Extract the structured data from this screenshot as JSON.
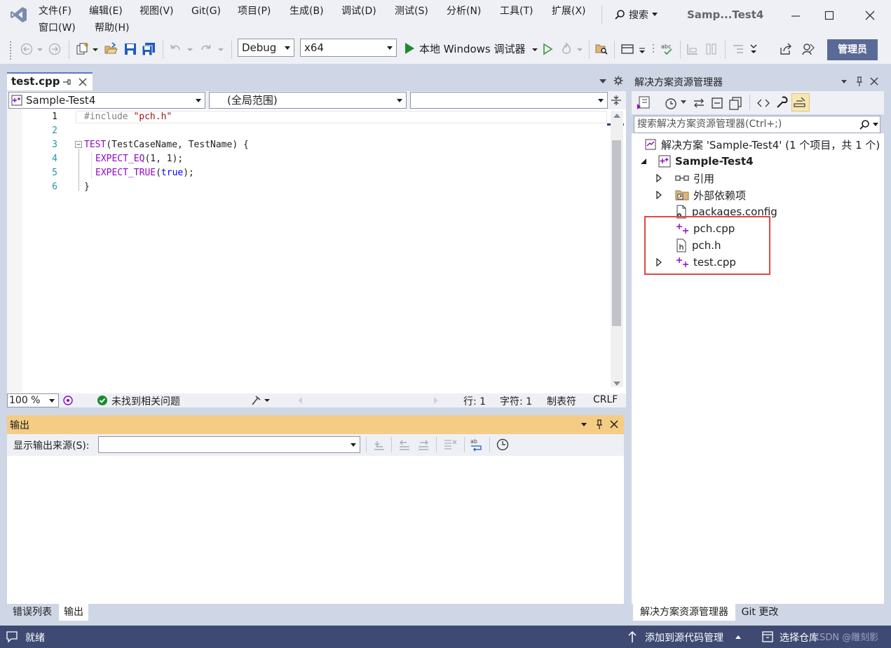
{
  "window": {
    "solution_title": "Samp...Test4",
    "search_label": "搜索"
  },
  "menu": {
    "file": "文件(F)",
    "edit": "编辑(E)",
    "view": "视图(V)",
    "git": "Git(G)",
    "project": "项目(P)",
    "build": "生成(B)",
    "debug": "调试(D)",
    "test": "测试(S)",
    "analyze": "分析(N)",
    "tools": "工具(T)",
    "extensions": "扩展(X)",
    "window": "窗口(W)",
    "help": "帮助(H)"
  },
  "toolbar": {
    "configuration": "Debug",
    "platform": "x64",
    "run_label": "本地 Windows 调试器",
    "admin_label": "管理员"
  },
  "editor": {
    "tab_label": "test.cpp",
    "nav_project": "Sample-Test4",
    "nav_scope": "(全局范围)",
    "lines": [
      {
        "num": "1",
        "text": "#include \"pch.h\""
      },
      {
        "num": "2",
        "text": ""
      },
      {
        "num": "3",
        "text": "TEST(TestCaseName, TestName) {"
      },
      {
        "num": "4",
        "text": "EXPECT_EQ(1, 1);"
      },
      {
        "num": "5",
        "text": "EXPECT_TRUE(true);"
      },
      {
        "num": "6",
        "text": "}"
      }
    ],
    "code": {
      "include_kw": "#include",
      "include_str": "\"pch.h\"",
      "test_macro": "TEST",
      "test_args": "(TestCaseName, TestName) {",
      "expect_eq": "EXPECT_EQ",
      "expect_eq_args": "(1, 1);",
      "expect_true": "EXPECT_TRUE",
      "expect_true_args": "(",
      "true_kw": "true",
      "expect_true_end": ");",
      "close_brace": "}"
    },
    "status": {
      "zoom": "100 %",
      "issues": "未找到相关问题",
      "line": "行: 1",
      "char": "字符: 1",
      "tabs": "制表符",
      "eol": "CRLF"
    }
  },
  "output": {
    "title": "输出",
    "source_label": "显示输出来源(S):",
    "source_value": ""
  },
  "bottom_tabs": {
    "error_list": "错误列表",
    "output": "输出"
  },
  "solution_explorer": {
    "title": "解决方案资源管理器",
    "search_placeholder": "搜索解决方案资源管理器(Ctrl+;)",
    "solution_label": "解决方案 'Sample-Test4' (1 个项目，共 1 个)",
    "project_label": "Sample-Test4",
    "items": {
      "references": "引用",
      "external_deps": "外部依赖项",
      "packages_config": "packages.config",
      "pch_cpp": "pch.cpp",
      "pch_h": "pch.h",
      "test_cpp": "test.cpp"
    },
    "tab_explorer": "解决方案资源管理器",
    "tab_git": "Git 更改"
  },
  "statusbar": {
    "ready": "就绪",
    "add_source_control": "添加到源代码管理",
    "select_repo": "选择仓库",
    "watermark": "CSDN @雕刻影"
  },
  "colors": {
    "accent": "#5b79c4",
    "statusbar": "#3e4a71",
    "output_header": "#f5cc84",
    "highlight_box": "#e04646"
  }
}
